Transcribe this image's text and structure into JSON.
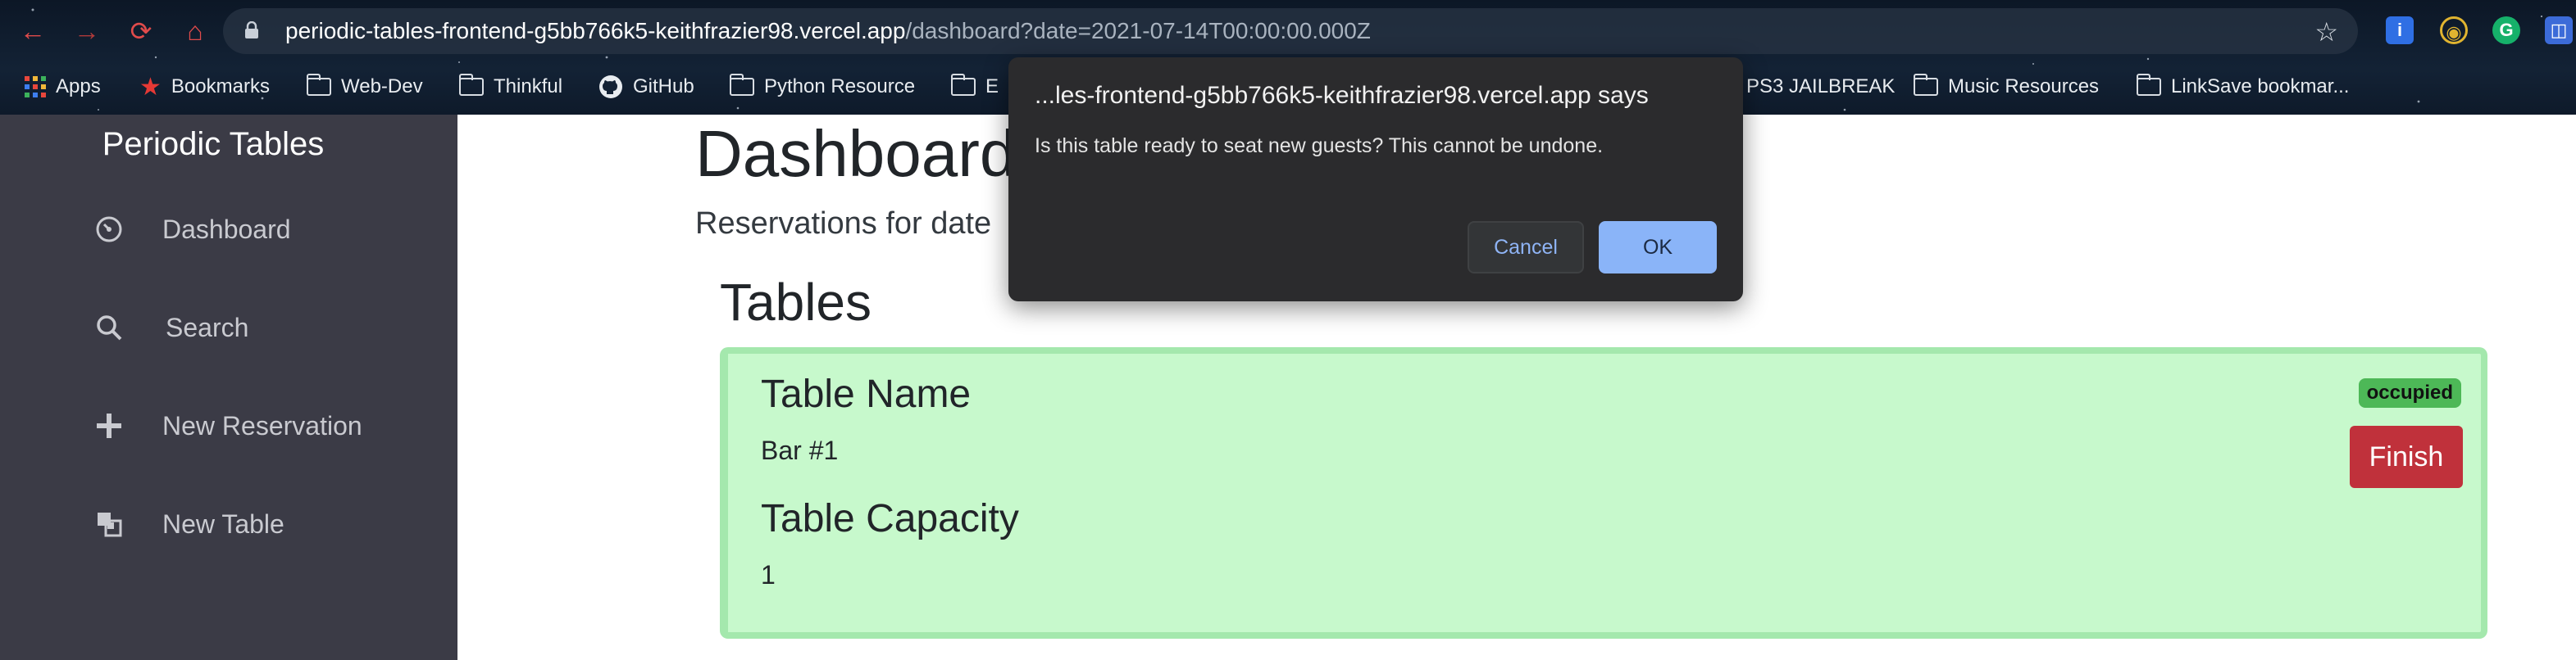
{
  "browser": {
    "url_host": "periodic-tables-frontend-g5bb766k5-keithfrazier98.vercel.app",
    "url_path": "/dashboard?date=2021-07-14T00:00:00.000Z",
    "bookmarks": [
      {
        "label": "Apps",
        "icon": "apps-grid-icon"
      },
      {
        "label": "Bookmarks",
        "icon": "star-icon"
      },
      {
        "label": "Web-Dev",
        "icon": "folder-icon"
      },
      {
        "label": "Thinkful",
        "icon": "folder-icon"
      },
      {
        "label": "GitHub",
        "icon": "github-icon"
      },
      {
        "label": "Python Resource",
        "icon": "folder-icon"
      },
      {
        "label": "E",
        "icon": "folder-icon"
      },
      {
        "label": "PS3 JAILBREAK",
        "icon": "folder-icon"
      },
      {
        "label": "Music Resources",
        "icon": "folder-icon"
      },
      {
        "label": "LinkSave bookmar...",
        "icon": "folder-icon"
      }
    ]
  },
  "sidebar": {
    "brand": "Periodic Tables",
    "items": [
      {
        "label": "Dashboard",
        "icon": "dashboard-gauge-icon"
      },
      {
        "label": "Search",
        "icon": "search-icon"
      },
      {
        "label": "New Reservation",
        "icon": "plus-icon"
      },
      {
        "label": "New Table",
        "icon": "layers-icon"
      }
    ]
  },
  "main": {
    "title": "Dashboard",
    "subtitle": "Reservations for date",
    "tables_heading": "Tables",
    "table_card": {
      "name_label": "Table Name",
      "name_value": "Bar #1",
      "capacity_label": "Table Capacity",
      "capacity_value": "1",
      "status_badge": "occupied",
      "finish_label": "Finish"
    }
  },
  "dialog": {
    "title": "...les-frontend-g5bb766k5-keithfrazier98.vercel.app says",
    "message": "Is this table ready to seat new guests? This cannot be undone.",
    "cancel_label": "Cancel",
    "ok_label": "OK"
  },
  "colors": {
    "sidebar_bg": "#3b3b46",
    "card_bg": "#c7f9cc",
    "badge_bg": "#4db857",
    "finish_bg": "#c0313b",
    "dialog_bg": "#2b2b2d",
    "dialog_ok": "#8ab4f8"
  }
}
